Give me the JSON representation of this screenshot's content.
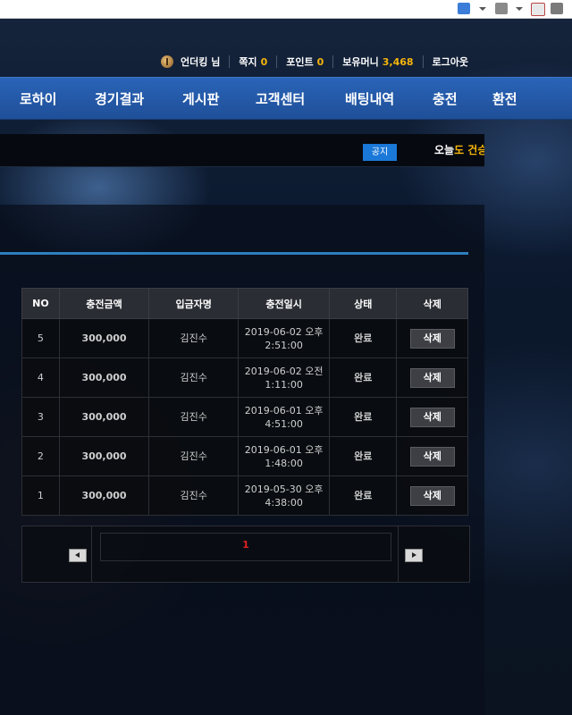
{
  "topinfo": {
    "user": "언더킹 님",
    "messages_label": "쪽지",
    "messages_count": "0",
    "points_label": "포인트",
    "points_value": "0",
    "money_label": "보유머니",
    "money_value": "3,468",
    "logout": "로그아웃"
  },
  "nav": {
    "items": [
      "로하이",
      "경기결과",
      "게시판",
      "고객센터",
      "배팅내역",
      "충전",
      "환전"
    ]
  },
  "notice": {
    "badge": "공지",
    "text_prefix": "오늘",
    "text_rest": "도 건승"
  },
  "table": {
    "headers": [
      "NO",
      "충전금액",
      "입금자명",
      "충전일시",
      "상태",
      "삭제"
    ],
    "rows": [
      {
        "no": "5",
        "amount": "300,000",
        "name": "김진수",
        "date": "2019-06-02 오후",
        "time": "2:51:00",
        "status": "완료",
        "delete": "삭제"
      },
      {
        "no": "4",
        "amount": "300,000",
        "name": "김진수",
        "date": "2019-06-02 오전",
        "time": "1:11:00",
        "status": "완료",
        "delete": "삭제"
      },
      {
        "no": "3",
        "amount": "300,000",
        "name": "김진수",
        "date": "2019-06-01 오후",
        "time": "4:51:00",
        "status": "완료",
        "delete": "삭제"
      },
      {
        "no": "2",
        "amount": "300,000",
        "name": "김진수",
        "date": "2019-06-01 오후",
        "time": "1:48:00",
        "status": "완료",
        "delete": "삭제"
      },
      {
        "no": "1",
        "amount": "300,000",
        "name": "김진수",
        "date": "2019-05-30 오후",
        "time": "4:38:00",
        "status": "완료",
        "delete": "삭제"
      }
    ]
  },
  "pager": {
    "current_page": "1"
  },
  "colors": {
    "accent": "#f5b50a",
    "nav_bg": "#2a64b8",
    "notice_badge": "#1a78d8",
    "page_active": "#e02020"
  },
  "icons": [
    "home-icon",
    "rss-icon",
    "mail-icon",
    "print-icon",
    "medal-icon",
    "prev-page-icon",
    "next-page-icon"
  ]
}
